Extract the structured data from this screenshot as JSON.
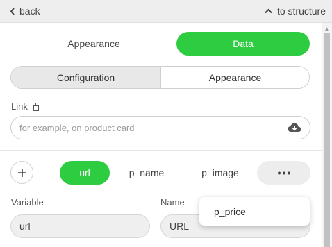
{
  "topbar": {
    "back_label": "back",
    "structure_label": "to structure"
  },
  "main_tabs": [
    {
      "label": "Appearance",
      "active": false
    },
    {
      "label": "Data",
      "active": true
    }
  ],
  "segment": {
    "configuration": "Configuration",
    "appearance": "Appearance",
    "selected": "Configuration"
  },
  "link": {
    "label": "Link",
    "placeholder": "for example, on product card",
    "value": ""
  },
  "variables": {
    "chips": [
      "url",
      "p_name",
      "p_image"
    ],
    "active": "url"
  },
  "fields": {
    "variable_label": "Variable",
    "variable_value": "url",
    "name_label": "Name",
    "name_value": "URL"
  },
  "popup": {
    "item": "p_price"
  },
  "colors": {
    "accent": "#2ecc40",
    "topbar": "#eeeeee"
  }
}
